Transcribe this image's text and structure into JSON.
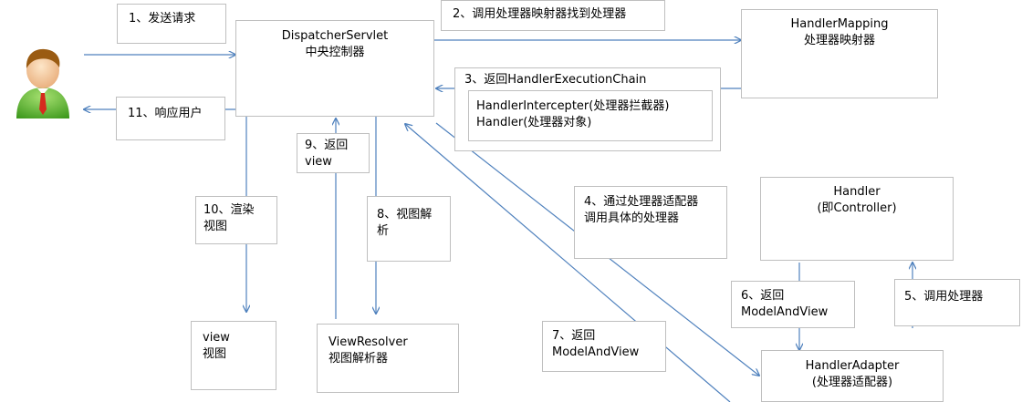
{
  "nodes": {
    "dispatcher": {
      "line1": "DispatcherServlet",
      "line2": "中央控制器"
    },
    "handler_mapping": {
      "line1": "HandlerMapping",
      "line2": "处理器映射器"
    },
    "chain_title": "3、返回HandlerExecutionChain",
    "chain_interceptor": "HandlerIntercepter(处理器拦截器)",
    "chain_handler": "Handler(处理器对象)",
    "handler": {
      "line1": "Handler",
      "line2": "(即Controller)"
    },
    "handler_adapter": {
      "line1": "HandlerAdapter",
      "line2": "(处理器适配器)"
    },
    "view_resolver": {
      "line1": "ViewResolver",
      "line2": "视图解析器"
    },
    "view": {
      "line1": "view",
      "line2": "视图"
    }
  },
  "steps": {
    "s1": "1、发送请求",
    "s2": "2、调用处理器映射器找到处理器",
    "s4": {
      "line1": "4、通过处理器适配器",
      "line2": "调用具体的处理器"
    },
    "s5": "5、调用处理器",
    "s6": {
      "line1": "6、返回",
      "line2": "ModelAndView"
    },
    "s7": {
      "line1": "7、返回",
      "line2": "ModelAndView"
    },
    "s8": {
      "line1": "8、视图解",
      "line2": "析"
    },
    "s9": {
      "line1": "9、返回",
      "line2": "view"
    },
    "s10": {
      "line1": "10、渲染",
      "line2": "视图"
    },
    "s11": "11、响应用户"
  },
  "colors": {
    "arrow": "#4f81bd",
    "border": "#bfbfbf"
  },
  "icons": {
    "user": "user-avatar-icon"
  }
}
